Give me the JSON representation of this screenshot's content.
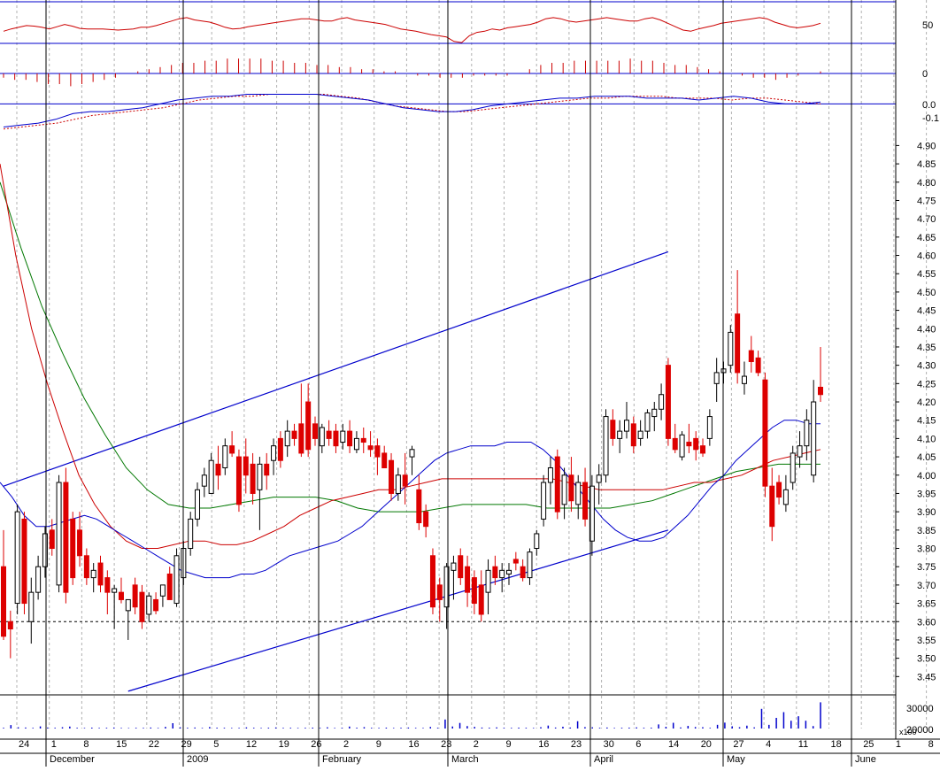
{
  "chart_data": {
    "type": "candlestick",
    "price_axis": {
      "ticks": [
        "4.90",
        "4.85",
        "4.80",
        "4.75",
        "4.70",
        "4.65",
        "4.60",
        "4.55",
        "4.50",
        "4.45",
        "4.40",
        "4.35",
        "4.30",
        "4.25",
        "4.20",
        "4.15",
        "4.10",
        "4.05",
        "4.00",
        "3.95",
        "3.90",
        "3.85",
        "3.80",
        "3.75",
        "3.70",
        "3.65",
        "3.60",
        "3.55",
        "3.50",
        "3.45"
      ],
      "ylim": [
        3.4,
        4.93
      ],
      "reference_line": 3.6
    },
    "rsi_axis": {
      "ticks": [
        "50"
      ],
      "ylim": [
        0,
        100
      ],
      "upper_line": 100,
      "lower_line": 30
    },
    "hist_axis": {
      "ticks": [
        "0"
      ]
    },
    "macd_axis": {
      "ticks": [
        "0.0",
        "-0.1"
      ],
      "ylim": [
        -0.15,
        0.08
      ]
    },
    "volume_axis": {
      "ticks": [
        "30000",
        "20000"
      ],
      "multiplier": "x100",
      "ylim": [
        0,
        40000
      ]
    },
    "x_day_labels": [
      "24",
      "1",
      "8",
      "15",
      "22",
      "29",
      "5",
      "12",
      "19",
      "26",
      "2",
      "9",
      "16",
      "23",
      "2",
      "9",
      "16",
      "23",
      "30",
      "6",
      "14",
      "20",
      "27",
      "4",
      "11",
      "18",
      "25",
      "1",
      "8"
    ],
    "x_month_labels": [
      "December",
      "2009",
      "February",
      "March",
      "April",
      "May",
      "June"
    ],
    "trend_channel": {
      "upper": [
        {
          "day": 0,
          "price": 3.97
        },
        {
          "day": 96,
          "price": 4.61
        }
      ],
      "lower": [
        {
          "day": 18,
          "price": 3.41
        },
        {
          "day": 96,
          "price": 3.85
        }
      ]
    },
    "candles": [
      [
        3.75,
        3.85,
        3.55,
        3.56
      ],
      [
        3.6,
        3.63,
        3.5,
        3.58
      ],
      [
        3.65,
        3.92,
        3.62,
        3.9
      ],
      [
        3.88,
        3.9,
        3.62,
        3.65
      ],
      [
        3.6,
        3.72,
        3.54,
        3.68
      ],
      [
        3.68,
        3.78,
        3.66,
        3.75
      ],
      [
        3.75,
        3.86,
        3.72,
        3.84
      ],
      [
        3.85,
        3.88,
        3.78,
        3.8
      ],
      [
        3.7,
        4.0,
        3.68,
        3.98
      ],
      [
        3.98,
        4.02,
        3.65,
        3.68
      ],
      [
        3.88,
        3.9,
        3.7,
        3.72
      ],
      [
        3.85,
        3.9,
        3.75,
        3.78
      ],
      [
        3.78,
        3.8,
        3.7,
        3.72
      ],
      [
        3.72,
        3.76,
        3.68,
        3.74
      ],
      [
        3.76,
        3.78,
        3.68,
        3.7
      ],
      [
        3.72,
        3.74,
        3.62,
        3.68
      ],
      [
        3.68,
        3.7,
        3.58,
        3.69
      ],
      [
        3.68,
        3.72,
        3.65,
        3.66
      ],
      [
        3.63,
        3.66,
        3.55,
        3.66
      ],
      [
        3.7,
        3.72,
        3.62,
        3.64
      ],
      [
        3.68,
        3.7,
        3.58,
        3.6
      ],
      [
        3.62,
        3.68,
        3.6,
        3.67
      ],
      [
        3.66,
        3.68,
        3.62,
        3.63
      ],
      [
        3.67,
        3.7,
        3.64,
        3.7
      ],
      [
        3.73,
        3.75,
        3.7,
        3.66
      ],
      [
        3.65,
        3.8,
        3.64,
        3.78
      ],
      [
        3.72,
        3.82,
        3.7,
        3.8
      ],
      [
        3.8,
        3.9,
        3.78,
        3.88
      ],
      [
        3.88,
        3.98,
        3.86,
        3.96
      ],
      [
        3.97,
        4.02,
        3.94,
        4.0
      ],
      [
        3.95,
        4.06,
        3.95,
        4.04
      ],
      [
        4.03,
        4.08,
        3.96,
        4.0
      ],
      [
        4.02,
        4.1,
        4.0,
        4.08
      ],
      [
        4.08,
        4.12,
        4.05,
        4.06
      ],
      [
        4.05,
        4.07,
        3.9,
        3.92
      ],
      [
        4.05,
        4.1,
        3.95,
        4.0
      ],
      [
        4.03,
        4.06,
        3.92,
        3.95
      ],
      [
        3.96,
        4.05,
        3.85,
        4.03
      ],
      [
        4.03,
        4.06,
        3.96,
        4.0
      ],
      [
        4.04,
        4.1,
        4.0,
        4.08
      ],
      [
        4.1,
        4.12,
        4.02,
        4.04
      ],
      [
        4.08,
        4.15,
        4.05,
        4.12
      ],
      [
        4.12,
        4.14,
        4.08,
        4.1
      ],
      [
        4.14,
        4.25,
        4.05,
        4.06
      ],
      [
        4.2,
        4.25,
        4.05,
        4.07
      ],
      [
        4.14,
        4.16,
        4.08,
        4.1
      ],
      [
        4.08,
        4.14,
        4.06,
        4.13
      ],
      [
        4.12,
        4.15,
        4.08,
        4.1
      ],
      [
        4.12,
        4.14,
        4.06,
        4.08
      ],
      [
        4.09,
        4.14,
        4.07,
        4.12
      ],
      [
        4.12,
        4.15,
        4.06,
        4.08
      ],
      [
        4.07,
        4.12,
        4.06,
        4.1
      ],
      [
        4.1,
        4.13,
        4.06,
        4.09
      ],
      [
        4.08,
        4.12,
        4.05,
        4.07
      ],
      [
        4.08,
        4.1,
        4.0,
        4.05
      ],
      [
        4.06,
        4.08,
        4.04,
        4.02
      ],
      [
        4.04,
        4.06,
        3.93,
        3.95
      ],
      [
        3.95,
        4.02,
        3.93,
        4.0
      ],
      [
        4.0,
        4.06,
        3.92,
        3.97
      ],
      [
        4.05,
        4.08,
        4.0,
        4.07
      ],
      [
        3.96,
        4.0,
        3.85,
        3.87
      ],
      [
        3.9,
        3.92,
        3.83,
        3.86
      ],
      [
        3.78,
        3.8,
        3.62,
        3.64
      ],
      [
        3.7,
        3.72,
        3.6,
        3.66
      ],
      [
        3.64,
        3.76,
        3.58,
        3.75
      ],
      [
        3.74,
        3.78,
        3.66,
        3.76
      ],
      [
        3.78,
        3.8,
        3.7,
        3.72
      ],
      [
        3.75,
        3.78,
        3.64,
        3.68
      ],
      [
        3.72,
        3.74,
        3.62,
        3.65
      ],
      [
        3.7,
        3.74,
        3.6,
        3.62
      ],
      [
        3.68,
        3.77,
        3.62,
        3.74
      ],
      [
        3.75,
        3.78,
        3.7,
        3.72
      ],
      [
        3.72,
        3.76,
        3.68,
        3.74
      ],
      [
        3.73,
        3.76,
        3.7,
        3.74
      ],
      [
        3.77,
        3.79,
        3.74,
        3.76
      ],
      [
        3.75,
        3.77,
        3.71,
        3.72
      ],
      [
        3.72,
        3.8,
        3.7,
        3.79
      ],
      [
        3.8,
        3.85,
        3.78,
        3.84
      ],
      [
        3.88,
        4.0,
        3.86,
        3.98
      ],
      [
        3.98,
        4.05,
        3.92,
        4.02
      ],
      [
        4.05,
        4.07,
        3.88,
        3.9
      ],
      [
        3.92,
        4.02,
        3.88,
        4.0
      ],
      [
        4.0,
        4.05,
        3.9,
        3.93
      ],
      [
        3.92,
        4.0,
        3.88,
        3.98
      ],
      [
        3.98,
        4.02,
        3.86,
        3.88
      ],
      [
        3.82,
        4.0,
        3.78,
        3.97
      ],
      [
        3.98,
        4.03,
        3.92,
        4.0
      ],
      [
        4.0,
        4.18,
        3.98,
        4.16
      ],
      [
        4.15,
        4.18,
        4.08,
        4.1
      ],
      [
        4.1,
        4.15,
        4.06,
        4.12
      ],
      [
        4.12,
        4.2,
        4.1,
        4.15
      ],
      [
        4.14,
        4.16,
        4.06,
        4.08
      ],
      [
        4.1,
        4.15,
        4.08,
        4.12
      ],
      [
        4.12,
        4.18,
        4.1,
        4.17
      ],
      [
        4.16,
        4.2,
        4.12,
        4.18
      ],
      [
        4.18,
        4.25,
        4.15,
        4.22
      ],
      [
        4.3,
        4.32,
        4.08,
        4.1
      ],
      [
        4.1,
        4.14,
        4.06,
        4.07
      ],
      [
        4.05,
        4.12,
        4.04,
        4.11
      ],
      [
        4.09,
        4.14,
        4.06,
        4.08
      ],
      [
        4.1,
        4.12,
        4.04,
        4.07
      ],
      [
        4.08,
        4.1,
        4.05,
        4.06
      ],
      [
        4.1,
        4.18,
        4.08,
        4.16
      ],
      [
        4.25,
        4.32,
        4.2,
        4.28
      ],
      [
        4.28,
        4.31,
        4.25,
        4.29
      ],
      [
        4.3,
        4.41,
        4.28,
        4.39
      ],
      [
        4.44,
        4.56,
        4.25,
        4.28
      ],
      [
        4.25,
        4.31,
        4.22,
        4.27
      ],
      [
        4.34,
        4.38,
        4.28,
        4.31
      ],
      [
        4.32,
        4.34,
        4.27,
        4.28
      ],
      [
        4.26,
        4.28,
        3.94,
        3.97
      ],
      [
        3.97,
        4.02,
        3.82,
        3.86
      ],
      [
        3.98,
        4.0,
        3.92,
        3.94
      ],
      [
        3.92,
        4.0,
        3.9,
        3.96
      ],
      [
        3.98,
        4.08,
        3.96,
        4.06
      ],
      [
        4.05,
        4.12,
        4.02,
        4.08
      ],
      [
        4.08,
        4.18,
        4.04,
        4.15
      ],
      [
        4.0,
        4.26,
        3.98,
        4.2
      ],
      [
        4.24,
        4.35,
        4.2,
        4.22
      ]
    ],
    "ma_short": [
      3.98,
      3.94,
      3.89,
      3.86,
      3.86,
      3.87,
      3.88,
      3.89,
      3.88,
      3.86,
      3.84,
      3.82,
      3.8,
      3.78,
      3.76,
      3.74,
      3.73,
      3.72,
      3.72,
      3.72,
      3.73,
      3.73,
      3.74,
      3.76,
      3.78,
      3.79,
      3.8,
      3.81,
      3.82,
      3.84,
      3.86,
      3.89,
      3.92,
      3.95,
      3.98,
      4.01,
      4.04,
      4.06,
      4.07,
      4.08,
      4.08,
      4.08,
      4.09,
      4.09,
      4.09,
      4.07,
      4.04,
      4.0,
      3.96,
      3.92,
      3.88,
      3.85,
      3.83,
      3.82,
      3.82,
      3.83,
      3.86,
      3.89,
      3.93,
      3.97,
      4.0,
      4.04,
      4.07,
      4.1,
      4.13,
      4.15,
      4.15,
      4.14,
      4.14
    ],
    "ma_mid": [
      4.85,
      4.6,
      4.4,
      4.25,
      4.12,
      4.0,
      3.92,
      3.86,
      3.82,
      3.8,
      3.8,
      3.81,
      3.82,
      3.82,
      3.81,
      3.81,
      3.82,
      3.84,
      3.86,
      3.89,
      3.91,
      3.93,
      3.94,
      3.95,
      3.96,
      3.96,
      3.97,
      3.98,
      3.99,
      3.99,
      3.99,
      3.99,
      3.99,
      3.99,
      3.99,
      3.99,
      3.98,
      3.97,
      3.96,
      3.96,
      3.96,
      3.96,
      3.96,
      3.97,
      3.98,
      3.98,
      3.99,
      4.0,
      4.02,
      4.04,
      4.05,
      4.06,
      4.07
    ],
    "ma_long": [
      4.8,
      4.62,
      4.46,
      4.33,
      4.21,
      4.11,
      4.02,
      3.96,
      3.92,
      3.91,
      3.91,
      3.92,
      3.93,
      3.94,
      3.94,
      3.94,
      3.93,
      3.91,
      3.9,
      3.9,
      3.9,
      3.91,
      3.92,
      3.92,
      3.92,
      3.92,
      3.91,
      3.91,
      3.91,
      3.91,
      3.92,
      3.93,
      3.95,
      3.97,
      3.99,
      4.01,
      4.02,
      4.03,
      4.03,
      4.03
    ],
    "rsi": [
      48,
      52,
      55,
      58,
      57,
      55,
      52,
      56,
      60,
      57,
      53,
      52,
      52,
      52,
      51,
      50,
      51,
      52,
      55,
      55,
      58,
      62,
      66,
      70,
      72,
      68,
      66,
      64,
      60,
      55,
      52,
      53,
      56,
      58,
      60,
      62,
      64,
      66,
      68,
      70,
      70,
      68,
      66,
      66,
      70,
      72,
      68,
      66,
      64,
      62,
      60,
      56,
      52,
      50,
      48,
      45,
      42,
      40,
      38,
      30,
      28,
      40,
      46,
      48,
      52,
      50,
      54,
      56,
      58,
      60,
      64,
      70,
      72,
      70,
      66,
      64,
      66,
      68,
      70,
      72,
      70,
      68,
      66,
      66,
      70,
      72,
      68,
      62,
      56,
      50,
      48,
      52,
      55,
      58,
      62,
      64,
      66,
      68,
      70,
      72,
      70,
      64,
      60,
      56,
      54,
      56,
      58,
      62
    ],
    "histogram": [
      -0.02,
      -0.03,
      -0.03,
      -0.04,
      -0.05,
      -0.05,
      -0.06,
      -0.05,
      -0.04,
      -0.03,
      -0.02,
      0.0,
      0.01,
      0.02,
      0.03,
      0.04,
      0.05,
      0.05,
      0.06,
      0.06,
      0.07,
      0.07,
      0.07,
      0.07,
      0.06,
      0.06,
      0.05,
      0.05,
      0.04,
      0.04,
      0.03,
      0.03,
      0.02,
      0.02,
      0.01,
      0.01,
      0.0,
      -0.01,
      -0.01,
      -0.02,
      -0.02,
      -0.02,
      -0.01,
      -0.01,
      -0.01,
      -0.01,
      0.0,
      0.02,
      0.04,
      0.05,
      0.05,
      0.06,
      0.06,
      0.06,
      0.06,
      0.06,
      0.07,
      0.06,
      0.06,
      0.05,
      0.04,
      0.04,
      0.03,
      0.02,
      0.01,
      0.0,
      -0.01,
      -0.02,
      -0.02,
      -0.03,
      -0.02,
      -0.01,
      0.0,
      0.01
    ],
    "macd": [
      -0.12,
      -0.11,
      -0.1,
      -0.08,
      -0.05,
      -0.04,
      -0.04,
      -0.03,
      -0.02,
      0.0,
      0.02,
      0.03,
      0.04,
      0.04,
      0.05,
      0.05,
      0.05,
      0.05,
      0.05,
      0.04,
      0.03,
      0.02,
      0.0,
      -0.02,
      -0.03,
      -0.04,
      -0.04,
      -0.03,
      -0.01,
      0.0,
      0.01,
      0.02,
      0.03,
      0.03,
      0.04,
      0.04,
      0.04,
      0.03,
      0.03,
      0.03,
      0.02,
      0.03,
      0.04,
      0.03,
      0.01,
      0.0,
      0.0,
      0.01
    ],
    "macd_signal": [
      -0.13,
      -0.12,
      -0.11,
      -0.1,
      -0.08,
      -0.06,
      -0.05,
      -0.04,
      -0.03,
      -0.02,
      0.0,
      0.02,
      0.03,
      0.04,
      0.04,
      0.05,
      0.05,
      0.05,
      0.05,
      0.04,
      0.03,
      0.01,
      -0.01,
      -0.02,
      -0.03,
      -0.04,
      -0.04,
      -0.03,
      -0.02,
      -0.01,
      0.0,
      0.01,
      0.02,
      0.03,
      0.03,
      0.04,
      0.04,
      0.04,
      0.03,
      0.03,
      0.03,
      0.02,
      0.03,
      0.03,
      0.02,
      0.01,
      0.0
    ],
    "volume": [
      900,
      4200,
      1500,
      1200,
      800,
      2600,
      1200,
      900,
      1600,
      2400,
      900,
      700,
      1100,
      800,
      900,
      1200,
      700,
      600,
      900,
      800,
      1200,
      700,
      2000,
      6500,
      1500,
      900,
      1200,
      700,
      1800,
      1000,
      900,
      700,
      800,
      1400,
      900,
      700,
      1000,
      1300,
      800,
      900,
      700,
      900,
      1100,
      800,
      1500,
      700,
      900,
      2400,
      1000,
      1700,
      900,
      800,
      1100,
      700,
      900,
      1200,
      800,
      700,
      1900,
      900,
      11000,
      2500,
      6800,
      3000,
      2000,
      1200,
      1000,
      1400,
      900,
      800,
      1100,
      900,
      700,
      1600,
      3600,
      1200,
      2200,
      1200,
      8900,
      1700,
      1500,
      900,
      1200,
      700,
      900,
      1100,
      1400,
      900,
      1000,
      5000,
      2100,
      7000,
      1300,
      3200,
      1800,
      1600,
      800,
      4500,
      7200,
      2700,
      1600,
      3500,
      1400,
      24000,
      4500,
      13000,
      20000,
      9500,
      15000,
      9500,
      3000,
      32000
    ]
  }
}
